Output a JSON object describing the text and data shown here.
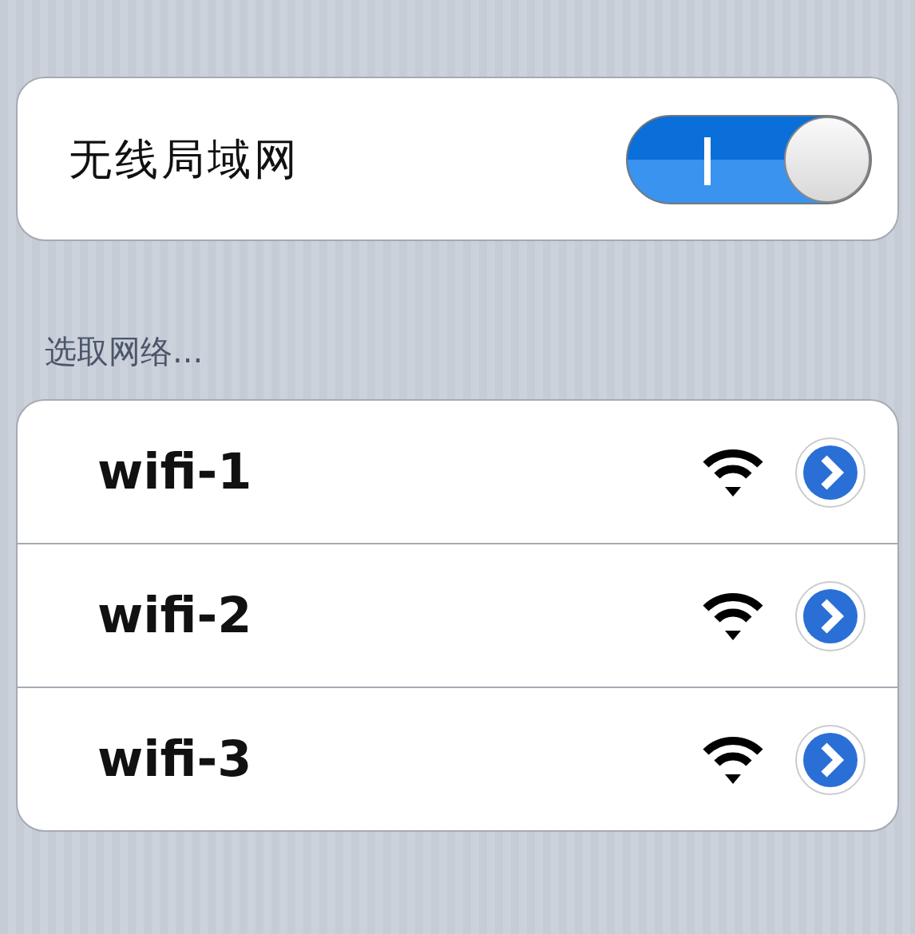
{
  "wifi_toggle": {
    "label": "无线局域网",
    "on": true
  },
  "section_header": "选取网络...",
  "networks": [
    {
      "name": "wifi-1"
    },
    {
      "name": "wifi-2"
    },
    {
      "name": "wifi-3"
    }
  ]
}
